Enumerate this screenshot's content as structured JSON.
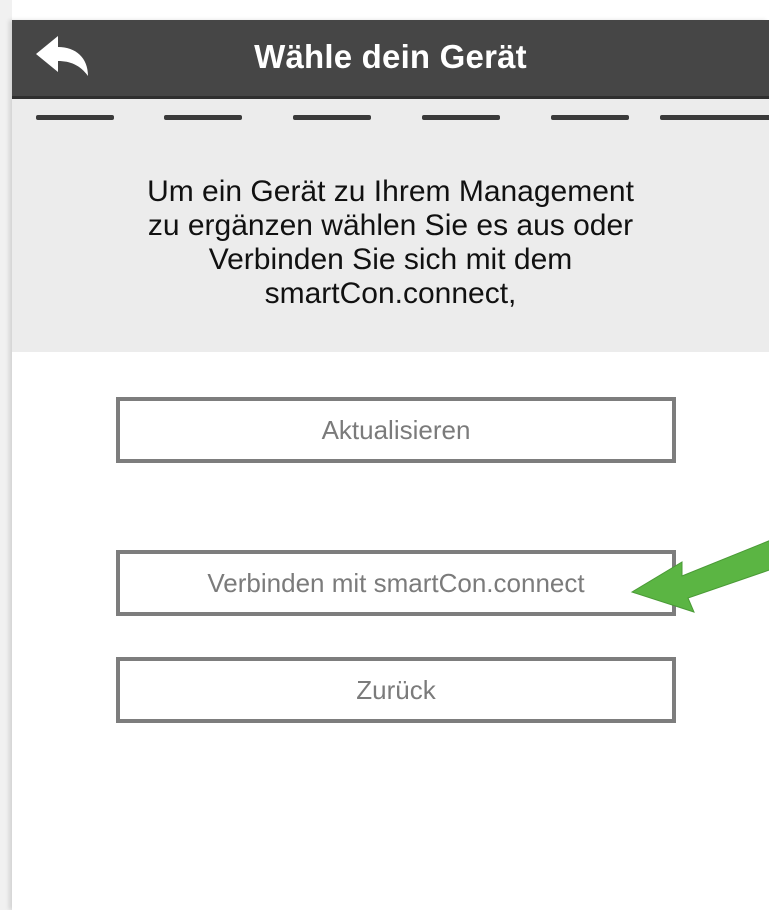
{
  "header": {
    "title": "Wähle dein Gerät",
    "back_icon": "back-arrow-icon",
    "background": "#464646"
  },
  "progress": {
    "total_steps": 6,
    "active_step": 6
  },
  "info": {
    "lines": [
      "Um ein Gerät zu Ihrem Management",
      "zu ergänzen wählen Sie es aus oder",
      "Verbinden Sie sich mit dem",
      "smartCon.connect,"
    ]
  },
  "buttons": {
    "refresh_label": "Aktualisieren",
    "connect_label": "Verbinden mit smartCon.connect",
    "back_label": "Zurück"
  },
  "annotation": {
    "icon": "green-pointer-arrow-icon",
    "color": "#5bb543"
  }
}
